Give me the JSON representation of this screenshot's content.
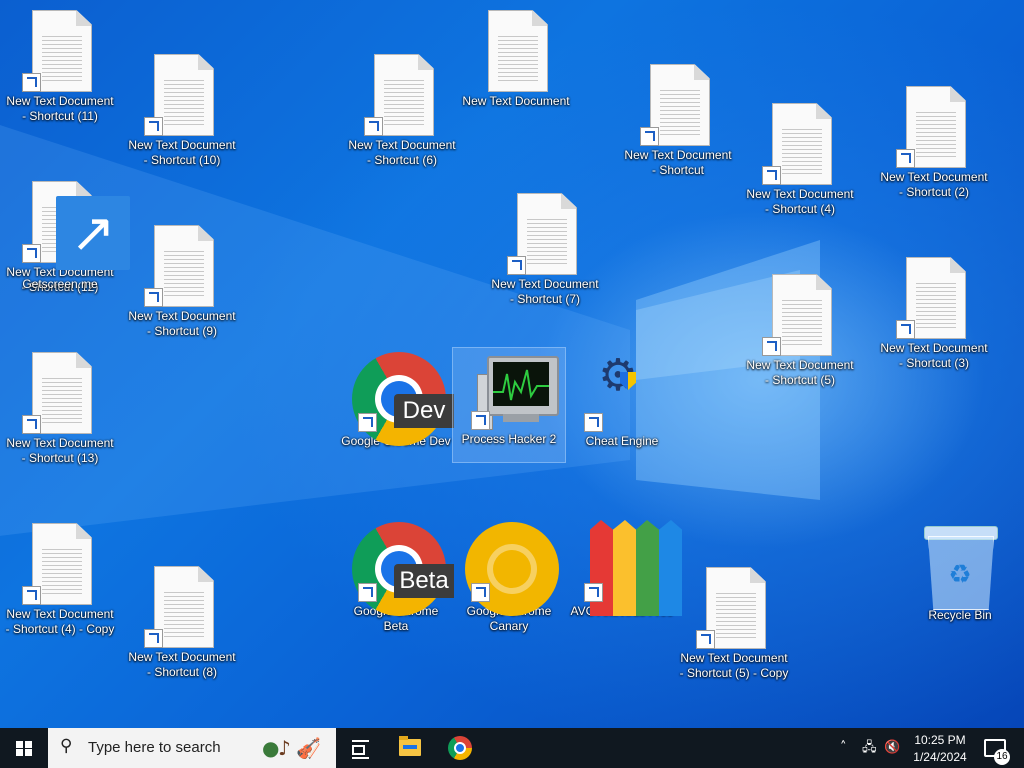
{
  "desktop": {
    "icons": [
      {
        "label": "New Text Document\n- Shortcut (11)"
      },
      {
        "label": "New Text Document\n- Shortcut (6)"
      },
      {
        "label": "New Text Document"
      },
      {
        "label": "New Text Document\n- Shortcut"
      },
      {
        "label": "New Text Document\n- Shortcut (4)"
      },
      {
        "label": "New Text Document\n- Shortcut (2)"
      },
      {
        "label": "New Text Document\n- Shortcut (10)"
      },
      {
        "label": "New Text Document\n- Shortcut (12)"
      },
      {
        "label": "Getscreen.me"
      },
      {
        "label": "New Text Document\n- Shortcut (9)"
      },
      {
        "label": "New Text Document\n- Shortcut (7)"
      },
      {
        "label": "New Text Document\n- Shortcut (5)"
      },
      {
        "label": "New Text Document\n- Shortcut (3)"
      },
      {
        "label": "New Text Document\n- Shortcut (13)"
      },
      {
        "label": "Google Chrome Dev"
      },
      {
        "label": "Process Hacker 2"
      },
      {
        "label": "Cheat Engine"
      },
      {
        "label": "New Text Document\n- Shortcut (4) - Copy"
      },
      {
        "label": "New Text Document\n- Shortcut (8)"
      },
      {
        "label": "Google Chrome\nBeta"
      },
      {
        "label": "Google Chrome\nCanary"
      },
      {
        "label": "AVG AntiVirus Free"
      },
      {
        "label": "New Text Document\n- Shortcut (5) - Copy"
      },
      {
        "label": "Recycle Bin"
      }
    ],
    "badges": {
      "dev": "Dev",
      "beta": "Beta"
    }
  },
  "taskbar": {
    "search_placeholder": "Type here to search",
    "clock_time": "10:25 PM",
    "clock_date": "1/24/2024",
    "notification_count": "16"
  }
}
